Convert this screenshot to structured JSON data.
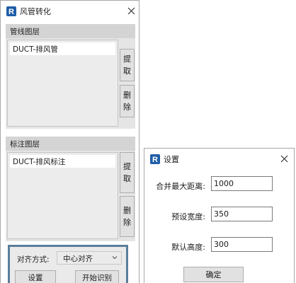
{
  "main_window": {
    "title": "风管转化",
    "pipe_layer_group": {
      "header": "管线图层",
      "selected_item": "DUCT-排风管",
      "extract_button": [
        "提",
        "取"
      ],
      "delete_button": [
        "删",
        "除"
      ]
    },
    "annotation_layer_group": {
      "header": "标注图层",
      "selected_item": "DUCT-排风标注",
      "extract_button": [
        "提",
        "取"
      ],
      "delete_button": [
        "删",
        "除"
      ]
    },
    "align_mode_label": "对齐方式:",
    "align_mode_value": "中心对齐",
    "settings_button": "设置",
    "start_recognition_button": "开始识别"
  },
  "settings_dialog": {
    "title": "设置",
    "merge_max_distance_label": "合并最大距离:",
    "merge_max_distance_value": "1000",
    "preset_width_label": "预设宽度:",
    "preset_width_value": "350",
    "default_height_label": "默认高度:",
    "default_height_value": "300",
    "ok_button": "确定"
  },
  "icons": {
    "app_icon": "revit-r-icon",
    "close_icon": "close-x-icon",
    "dropdown_icon": "chevron-down-icon"
  },
  "colors": {
    "app_icon_blue": "#1f5da8",
    "focus_border": "#5a7e9b",
    "group_header": "#d4d4d4"
  }
}
